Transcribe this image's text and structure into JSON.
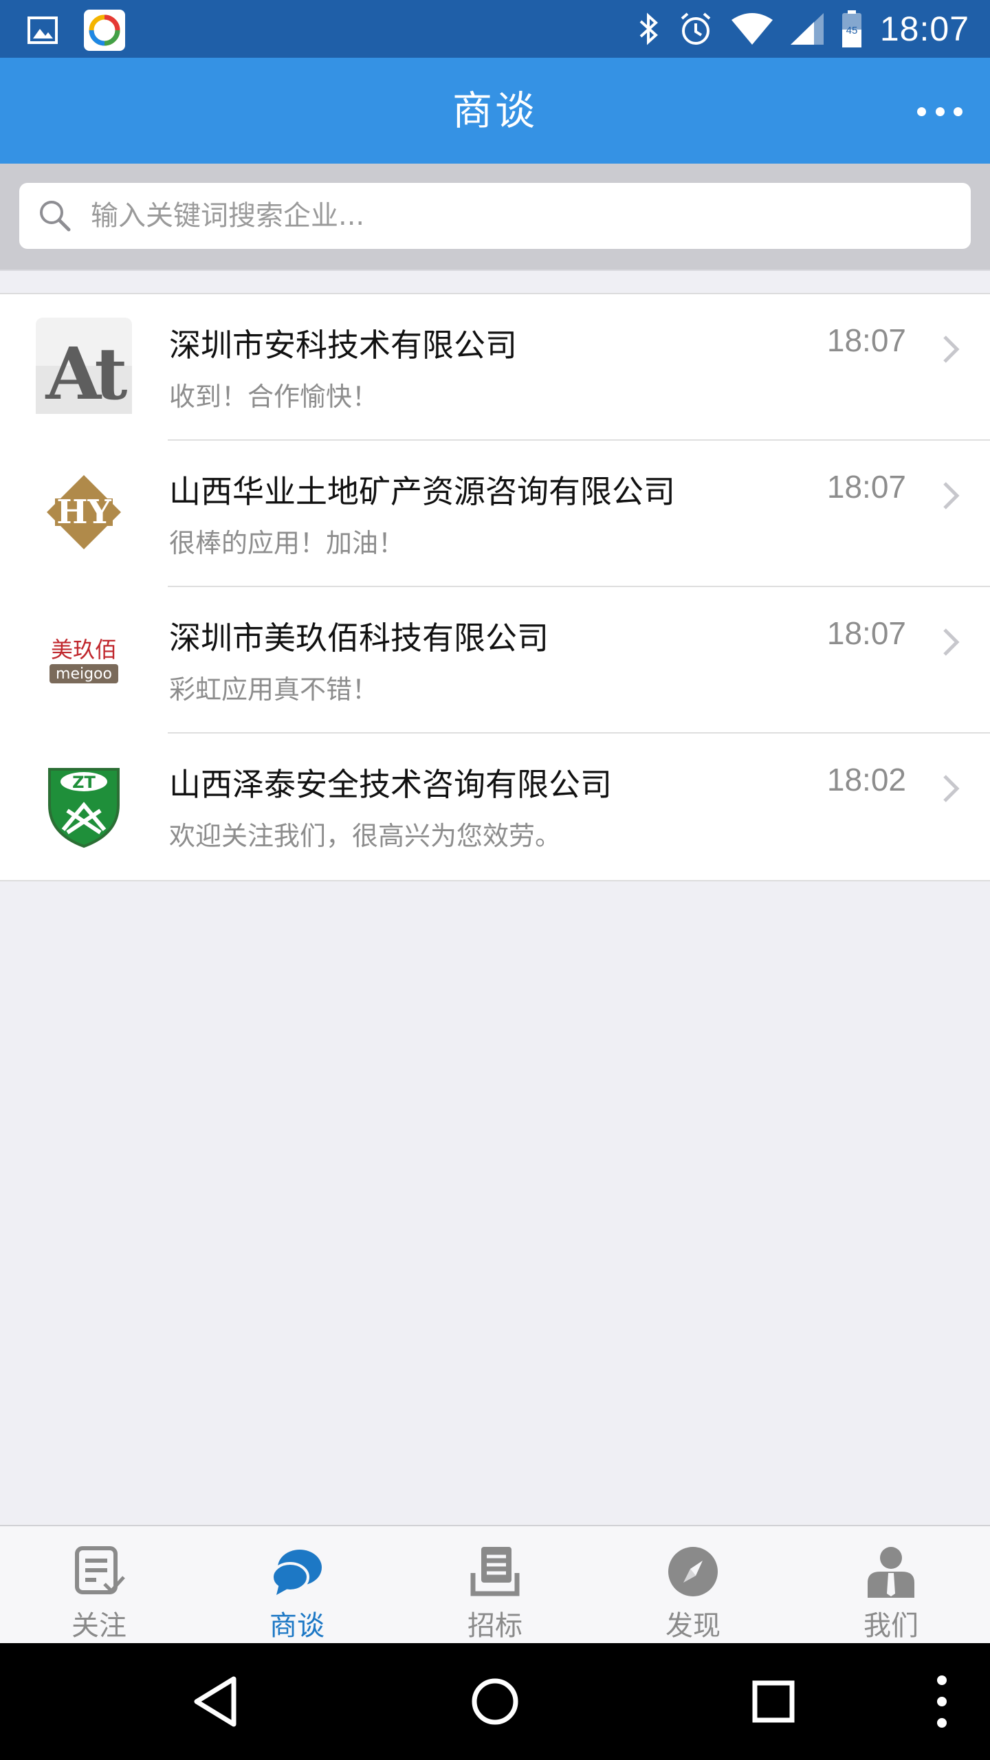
{
  "status_bar": {
    "time": "18:07",
    "battery_level": "45"
  },
  "header": {
    "title": "商谈",
    "more_label": "更多"
  },
  "search": {
    "placeholder": "输入关键词搜索企业..."
  },
  "chats": [
    {
      "name": "深圳市安科技术有限公司",
      "message": "收到！合作愉快！",
      "time": "18:07",
      "logo_text": "At"
    },
    {
      "name": "山西华业土地矿产资源咨询有限公司",
      "message": "很棒的应用！加油！",
      "time": "18:07",
      "logo_text": "HY"
    },
    {
      "name": "深圳市美玖佰科技有限公司",
      "message": "彩虹应用真不错！",
      "time": "18:07",
      "logo_text": "美玖佰",
      "logo_subtext": "meigoo"
    },
    {
      "name": "山西泽泰安全技术咨询有限公司",
      "message": "欢迎关注我们，很高兴为您效劳。",
      "time": "18:02",
      "logo_text": "ZT"
    }
  ],
  "tabs": [
    {
      "label": "关注",
      "icon": "list-check-icon",
      "active": false
    },
    {
      "label": "商谈",
      "icon": "chat-bubble-icon",
      "active": true
    },
    {
      "label": "招标",
      "icon": "document-stack-icon",
      "active": false
    },
    {
      "label": "发现",
      "icon": "compass-icon",
      "active": false
    },
    {
      "label": "我们",
      "icon": "person-icon",
      "active": false
    }
  ],
  "colors": {
    "header": "#3592e4",
    "status_bar": "#1f5fa8",
    "active_tab": "#1d78c5",
    "inactive_tab": "#8a8a8a"
  }
}
